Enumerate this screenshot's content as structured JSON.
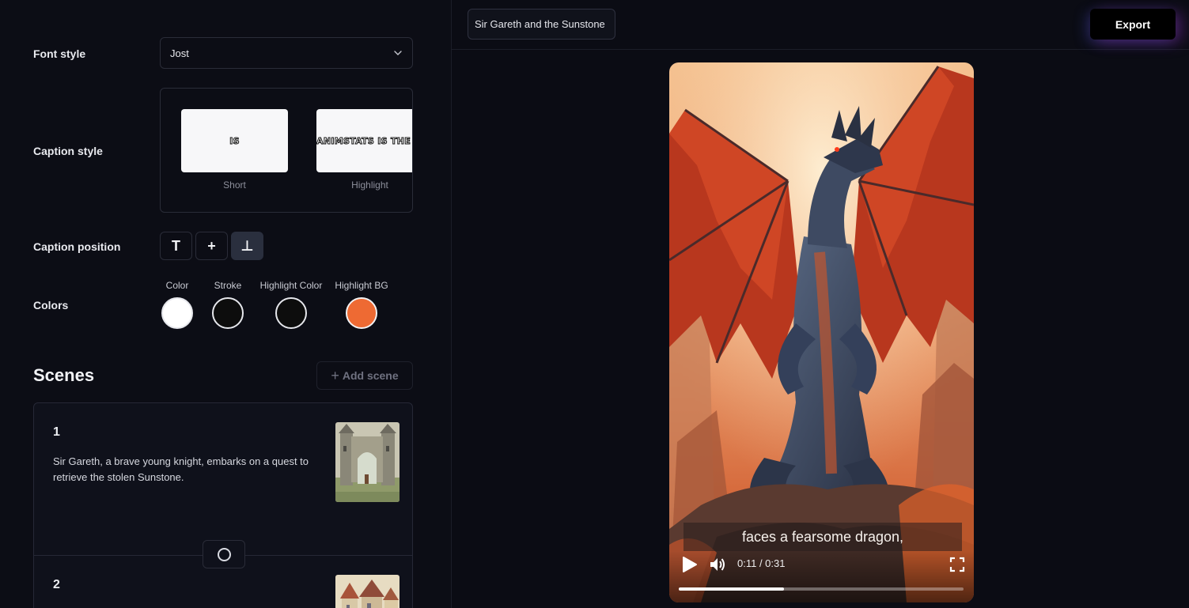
{
  "settings": {
    "font_style": {
      "label": "Font style",
      "value": "Jost"
    },
    "caption_style": {
      "label": "Caption style",
      "options": [
        {
          "name": "Short",
          "preview_text": "IS"
        },
        {
          "name": "Highlight",
          "preview_text": "ANIMSTATS IS THE BE"
        }
      ]
    },
    "caption_position": {
      "label": "Caption position",
      "options": [
        {
          "name": "top",
          "glyph": "T"
        },
        {
          "name": "middle",
          "glyph": "+"
        },
        {
          "name": "bottom",
          "glyph": "⊥",
          "selected": true
        }
      ]
    },
    "colors": {
      "label": "Colors",
      "items": [
        {
          "label": "Color",
          "value": "#ffffff"
        },
        {
          "label": "Stroke",
          "value": "#0d0d0d"
        },
        {
          "label": "Highlight Color",
          "value": "#0d0d0d"
        },
        {
          "label": "Highlight BG",
          "value": "#ee6a33"
        }
      ]
    }
  },
  "scenes": {
    "title": "Scenes",
    "add_label": "Add scene",
    "items": [
      {
        "number": "1",
        "text": "Sir Gareth, a brave young knight, embarks on a quest to retrieve the stolen Sunstone."
      },
      {
        "number": "2",
        "text": ""
      }
    ]
  },
  "header": {
    "project_title": "Sir Gareth and the Sunstone",
    "export_label": "Export"
  },
  "player": {
    "caption": "faces a fearsome dragon,",
    "time": "0:11 / 0:31",
    "progress": 0.37
  }
}
